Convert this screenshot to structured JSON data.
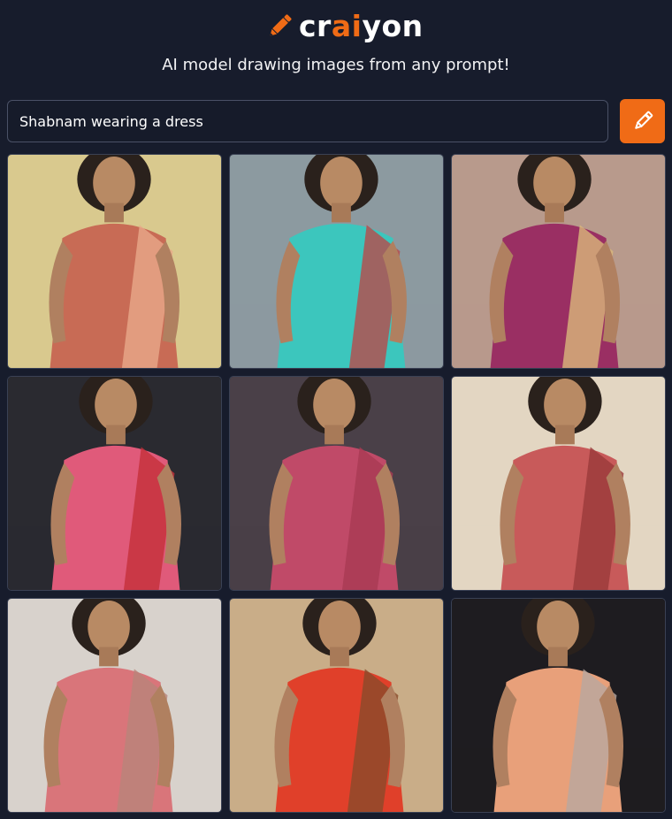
{
  "app": {
    "logo_parts": [
      "cr",
      "ai",
      "yon"
    ],
    "logo_icon": "pencil-icon",
    "accent_color": "#f06b16",
    "tagline": "AI model drawing images from any prompt!"
  },
  "prompt": {
    "value": "Shabnam wearing a dress",
    "button_icon": "pencil-icon"
  },
  "results": {
    "count": 9,
    "images": [
      {
        "bg": "#d9c98e",
        "outfit": "#c86b55",
        "accent": "#e8a98a"
      },
      {
        "bg": "#8c9aa0",
        "outfit": "#3cc6bd",
        "accent": "#b84a4a"
      },
      {
        "bg": "#b89a8c",
        "outfit": "#9a2f63",
        "accent": "#d9b87a"
      },
      {
        "bg": "#2a2a30",
        "outfit": "#e05a7a",
        "accent": "#c4303a"
      },
      {
        "bg": "#4a4048",
        "outfit": "#c04a68",
        "accent": "#a83a52"
      },
      {
        "bg": "#e3d6c2",
        "outfit": "#c85a5a",
        "accent": "#9a3a3a"
      },
      {
        "bg": "#d8d2cc",
        "outfit": "#d9757a",
        "accent": "#b8857a"
      },
      {
        "bg": "#c9ad88",
        "outfit": "#e0402a",
        "accent": "#8a4a2a"
      },
      {
        "bg": "#1e1c20",
        "outfit": "#e8a07a",
        "accent": "#b8a8a0"
      }
    ]
  }
}
